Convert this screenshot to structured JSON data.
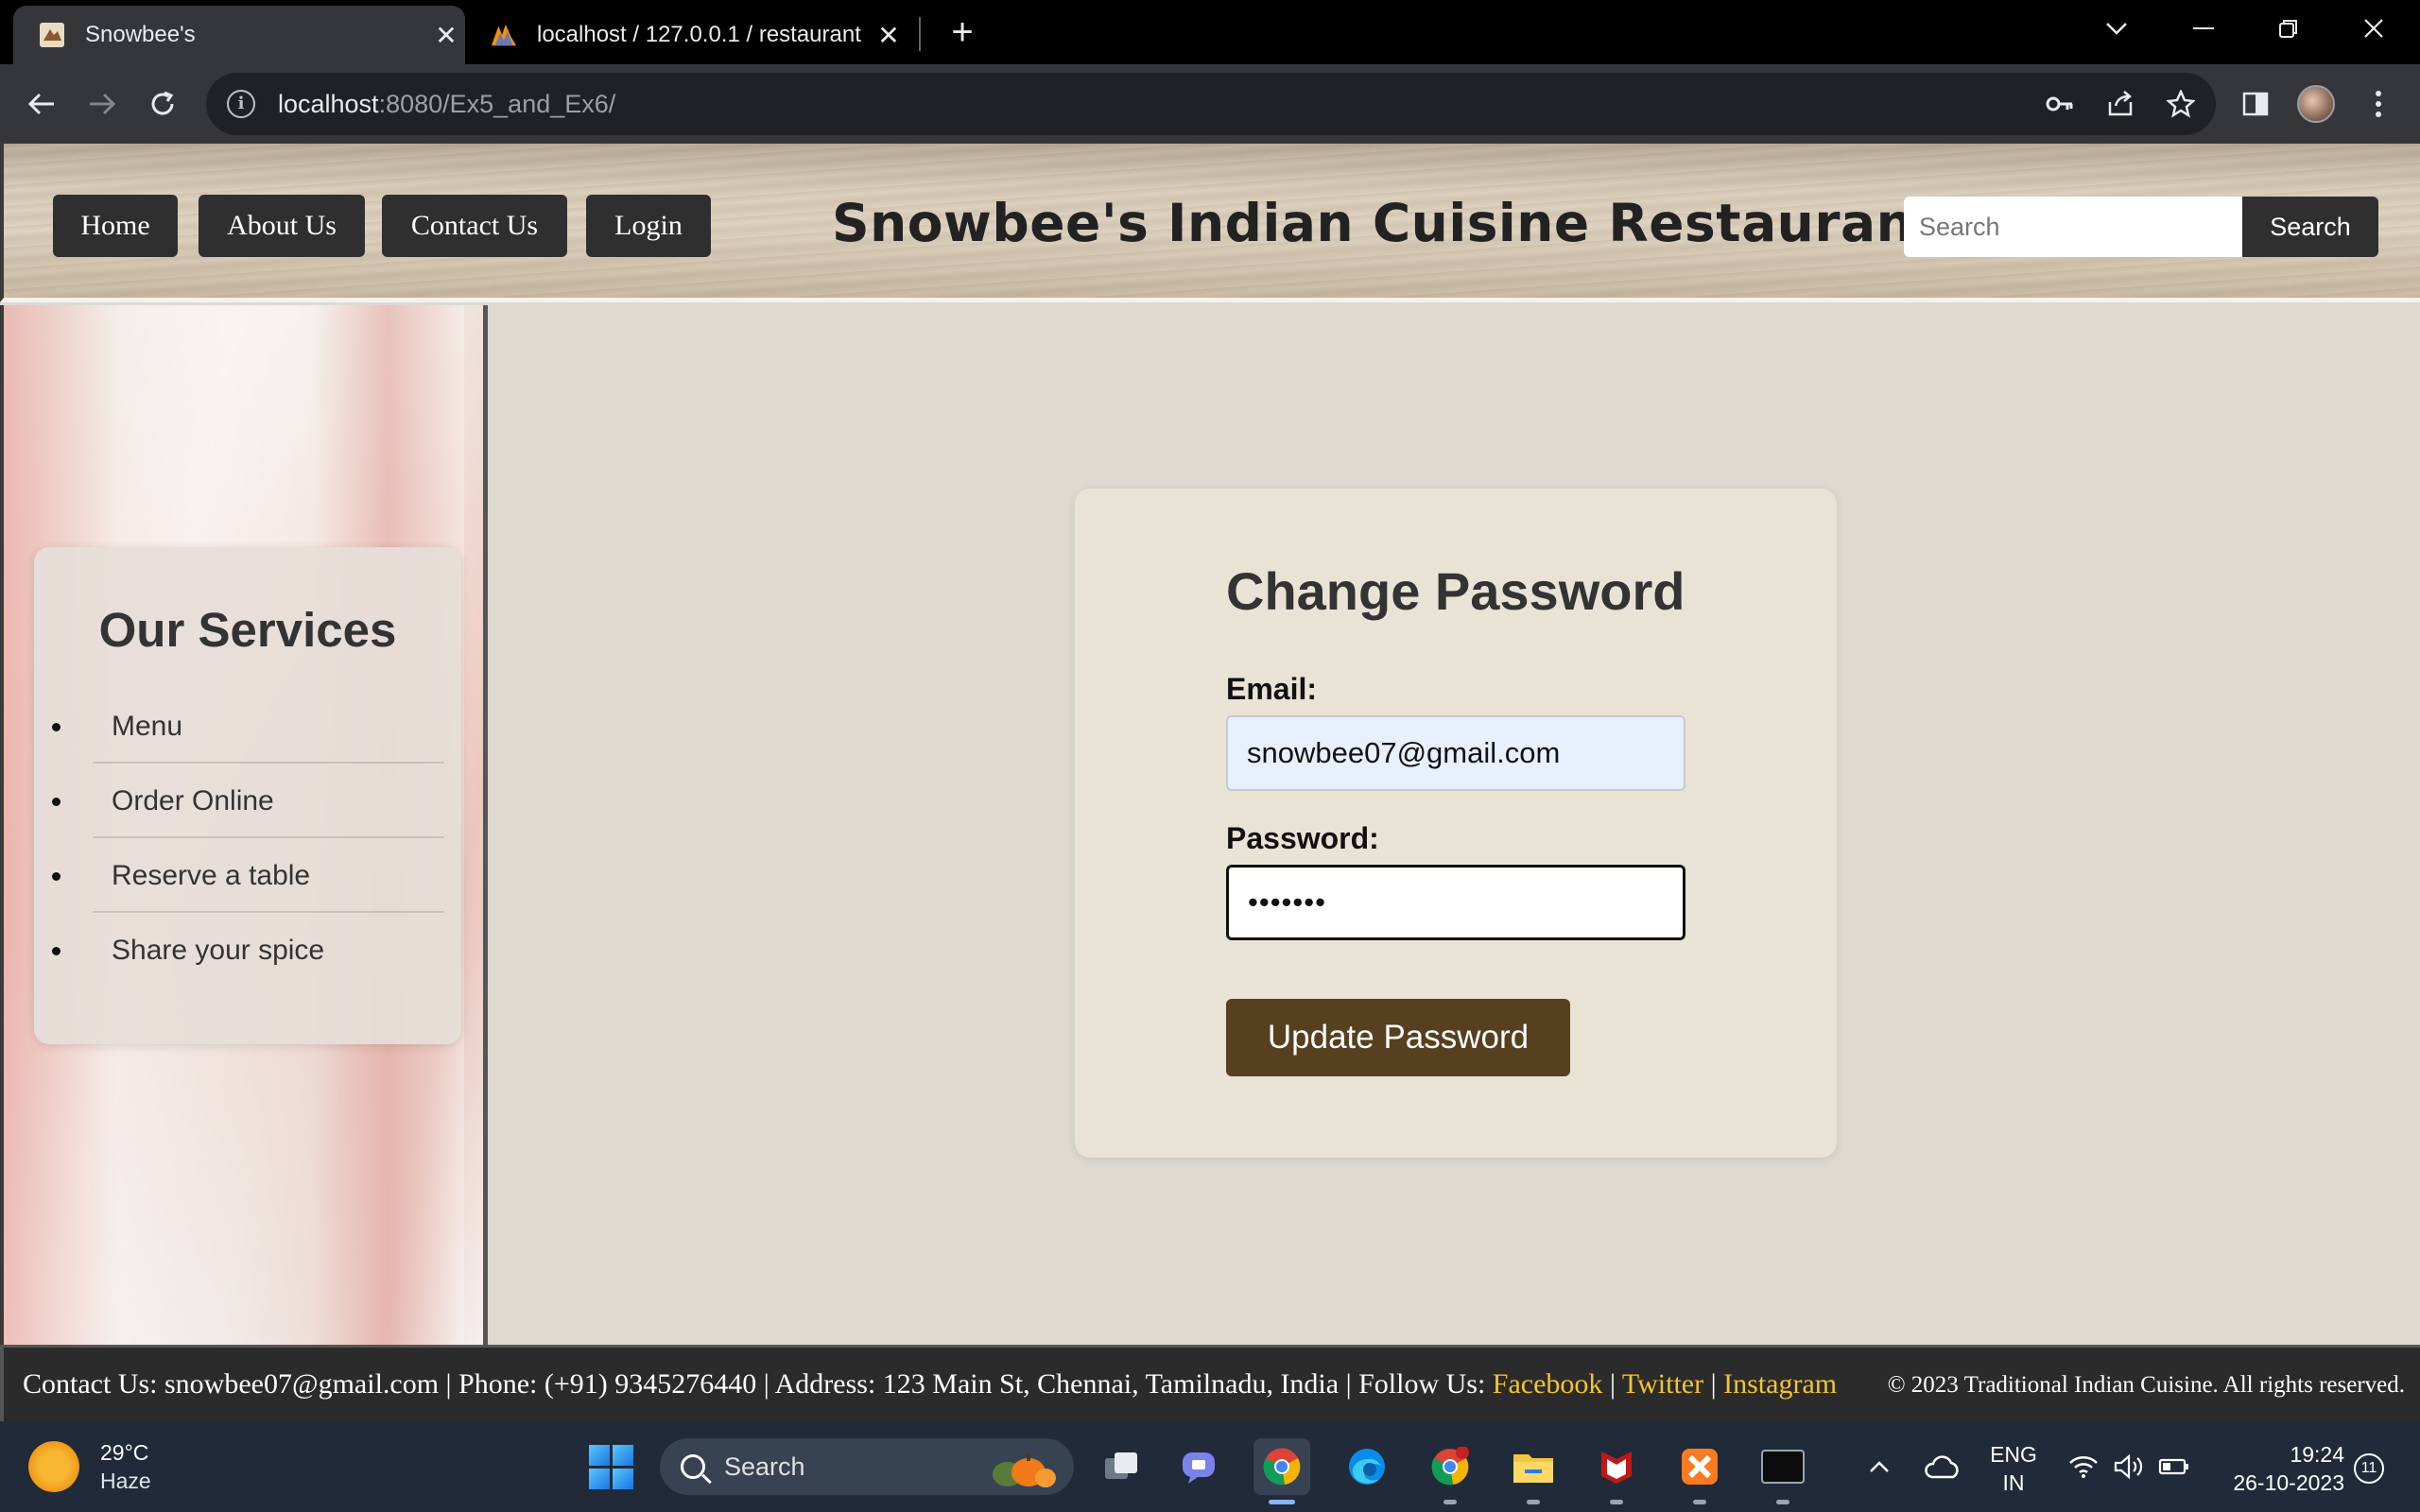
{
  "browser": {
    "tabs": [
      {
        "title": "Snowbee's",
        "active": true
      },
      {
        "title": "localhost / 127.0.0.1 / restaurant",
        "active": false
      }
    ],
    "url_host": "localhost",
    "url_path": ":8080/Ex5_and_Ex6/"
  },
  "site": {
    "nav": [
      "Home",
      "About Us",
      "Contact Us",
      "Login"
    ],
    "title": "Snowbee's Indian Cuisine Restaurant",
    "search_placeholder": "Search",
    "search_button": "Search"
  },
  "sidebar": {
    "heading": "Our Services",
    "items": [
      "Menu",
      "Order Online",
      "Reserve a table",
      "Share your spice"
    ]
  },
  "form": {
    "heading": "Change Password",
    "email_label": "Email:",
    "email_value": "snowbee07@gmail.com",
    "password_label": "Password:",
    "password_value": "•••••••",
    "submit_label": "Update Password"
  },
  "footer": {
    "contact_prefix": "Contact Us: snowbee07@gmail.com | Phone: (+91) 9345276440 | Address: 123 Main St, Chennai, Tamilnadu, India | Follow Us: ",
    "links": [
      "Facebook",
      "Twitter",
      "Instagram"
    ],
    "separator": " | ",
    "copyright": "© 2023 Traditional Indian Cuisine. All rights reserved."
  },
  "taskbar": {
    "temperature": "29°C",
    "weather": "Haze",
    "search_label": "Search",
    "lang_top": "ENG",
    "lang_bottom": "IN",
    "time": "19:24",
    "date": "26-10-2023",
    "notifications": "11"
  },
  "colors": {
    "footer_link": "#f4c430",
    "submit_button": "#56401f",
    "card_background": "#e9e3d6",
    "email_autofill": "#e8f0fe"
  }
}
